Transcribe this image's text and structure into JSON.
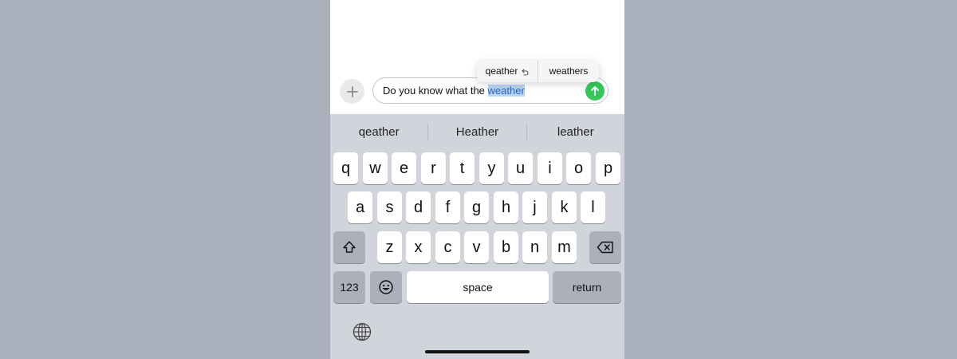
{
  "compose": {
    "text_prefix": "Do you know what the ",
    "text_selected": "weather",
    "plus_icon": "plus-icon",
    "send_icon": "arrow-up-icon",
    "send_color": "#34c759"
  },
  "replacement_popup": {
    "items": [
      "qeather",
      "weathers"
    ],
    "undo_icon": "undo-arrow-icon"
  },
  "keyboard": {
    "suggestions": [
      "qeather",
      "Heather",
      "leather"
    ],
    "row1": [
      "q",
      "w",
      "e",
      "r",
      "t",
      "y",
      "u",
      "i",
      "o",
      "p"
    ],
    "row2": [
      "a",
      "s",
      "d",
      "f",
      "g",
      "h",
      "j",
      "k",
      "l"
    ],
    "row3": [
      "z",
      "x",
      "c",
      "v",
      "b",
      "n",
      "m"
    ],
    "numbers_label": "123",
    "space_label": "space",
    "return_label": "return",
    "shift_icon": "shift-icon",
    "delete_icon": "backspace-icon",
    "emoji_icon": "emoji-icon",
    "globe_icon": "globe-icon"
  },
  "colors": {
    "background": "#a9afbb",
    "keyboard_bg": "#d1d4da",
    "selection": "#b9d3f3"
  }
}
